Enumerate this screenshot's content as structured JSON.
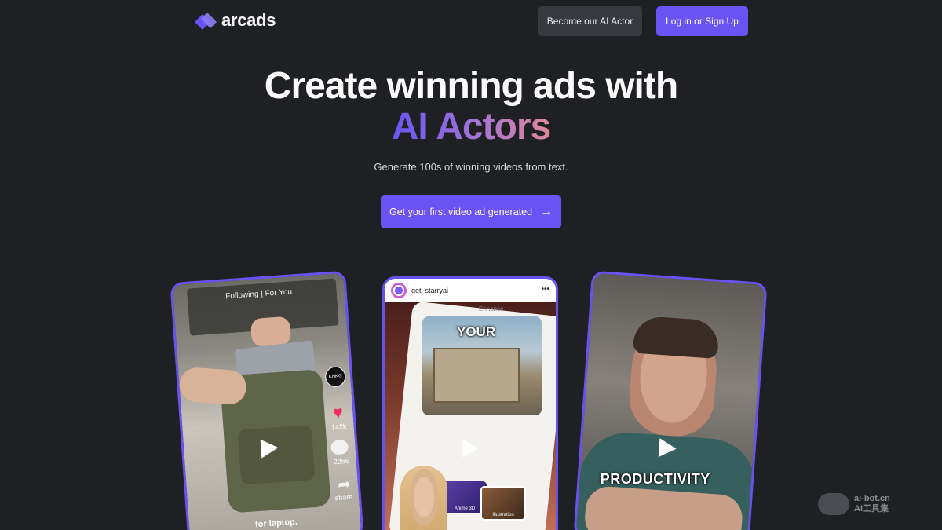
{
  "header": {
    "logo_text": "arcads",
    "become_actor_label": "Become our AI Actor",
    "login_label": "Log in or Sign Up"
  },
  "hero": {
    "title_line1": "Create winning ads with",
    "title_line2": "AI Actors",
    "subtitle": "Generate 100s of winning videos from text.",
    "cta_label": "Get your first video ad generated",
    "cta_icon": "arrow-right-icon"
  },
  "videos": [
    {
      "platform": "tiktok",
      "tabs": "Following | For You",
      "avatar_text": "KNKG",
      "likes": "142k",
      "comments": "2256",
      "share_label": "share",
      "caption": "for laptop."
    },
    {
      "platform": "instagram",
      "username": "get_starryai",
      "enhance_label": "Enhance",
      "overlay_text": "YOUR",
      "thumb_1": "Anime 3D",
      "thumb_2": "Illustration"
    },
    {
      "platform": "video",
      "caption": "PRODUCTIVITY"
    }
  ],
  "watermark": {
    "line1": "ai-bot.cn",
    "line2": "AI工具集"
  },
  "colors": {
    "background": "#1f2024",
    "accent": "#6b52f3",
    "secondary_button": "#383a40"
  }
}
